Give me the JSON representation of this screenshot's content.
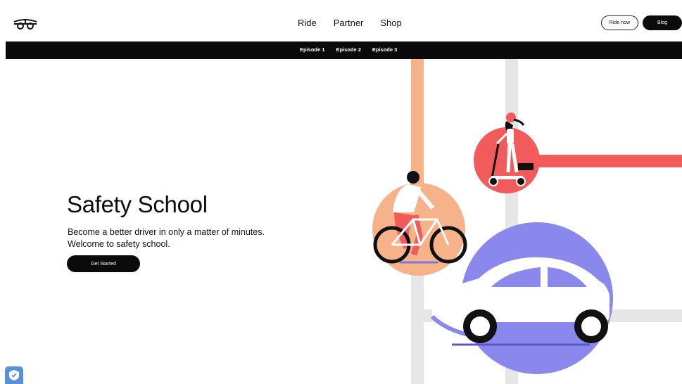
{
  "header": {
    "logo_icon": "bird-logo-icon",
    "nav": [
      "Ride",
      "Partner",
      "Shop"
    ],
    "ride_now_label": "Ride now",
    "blog_label": "Blog"
  },
  "episodes": [
    "Episode 1",
    "Episode 2",
    "Episode 3"
  ],
  "hero": {
    "title": "Safety School",
    "subtitle_line1": "Become a better driver in only a matter of minutes.",
    "subtitle_line2": "Welcome to safety school.",
    "cta_label": "Get Started"
  },
  "colors": {
    "black": "#0b0b0b",
    "peach": "#f6b38a",
    "coral": "#f25b5b",
    "periwinkle": "#8a88ec",
    "road_gray": "#e6e6e6"
  },
  "badge": {
    "icon": "shield-check-icon"
  }
}
